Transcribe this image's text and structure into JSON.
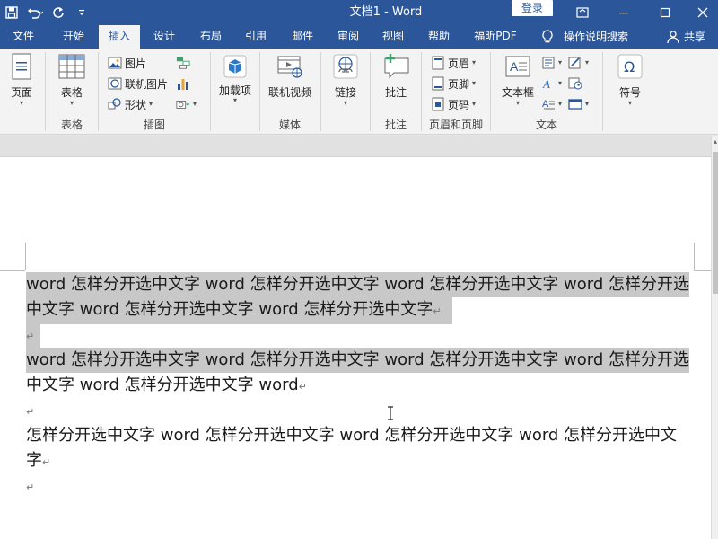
{
  "titlebar": {
    "title": "文档1  -  Word",
    "login_label": "登录",
    "color": "#2b579a"
  },
  "tabs": {
    "items": [
      "文件",
      "开始",
      "插入",
      "设计",
      "布局",
      "引用",
      "邮件",
      "审阅",
      "视图",
      "帮助",
      "福昕PDF"
    ],
    "active": "插入",
    "tellme": "操作说明搜索",
    "share": "共享"
  },
  "ribbon": {
    "page": {
      "label": "页面",
      "group": ""
    },
    "table": {
      "label": "表格",
      "group": "表格"
    },
    "illustrations": {
      "picture": "图片",
      "online_picture": "联机图片",
      "shapes": "形状",
      "group": "插图"
    },
    "addins": {
      "label": "加载项",
      "label_line2": "项"
    },
    "media": {
      "label": "联机视频",
      "group": "媒体"
    },
    "links": {
      "label": "链接"
    },
    "comments": {
      "label": "批注",
      "group": "批注"
    },
    "header_footer": {
      "header": "页眉",
      "footer": "页脚",
      "page_number": "页码",
      "group": "页眉和页脚"
    },
    "text": {
      "textbox": "文本框",
      "group": "文本"
    },
    "symbols": {
      "label": "符号"
    }
  },
  "document": {
    "lines": [
      "word 怎样分开选中文字 word 怎样分开选中文字 word 怎样分开选中文字 word 怎样分开选",
      "中文字 word 怎样分开选中文字 word 怎样分开选中文字",
      "",
      "word 怎样分开选中文字 word 怎样分开选中文字 word 怎样分开选中文字 word 怎样分开选",
      "中文字 word 怎样分开选中文字 word",
      "",
      "怎样分开选中文字 word 怎样分开选中文字 word 怎样分开选中文字 word 怎样分开选中文",
      "字",
      ""
    ],
    "paragraph_mark": "↵",
    "selection_color": "#c8c8c8"
  }
}
